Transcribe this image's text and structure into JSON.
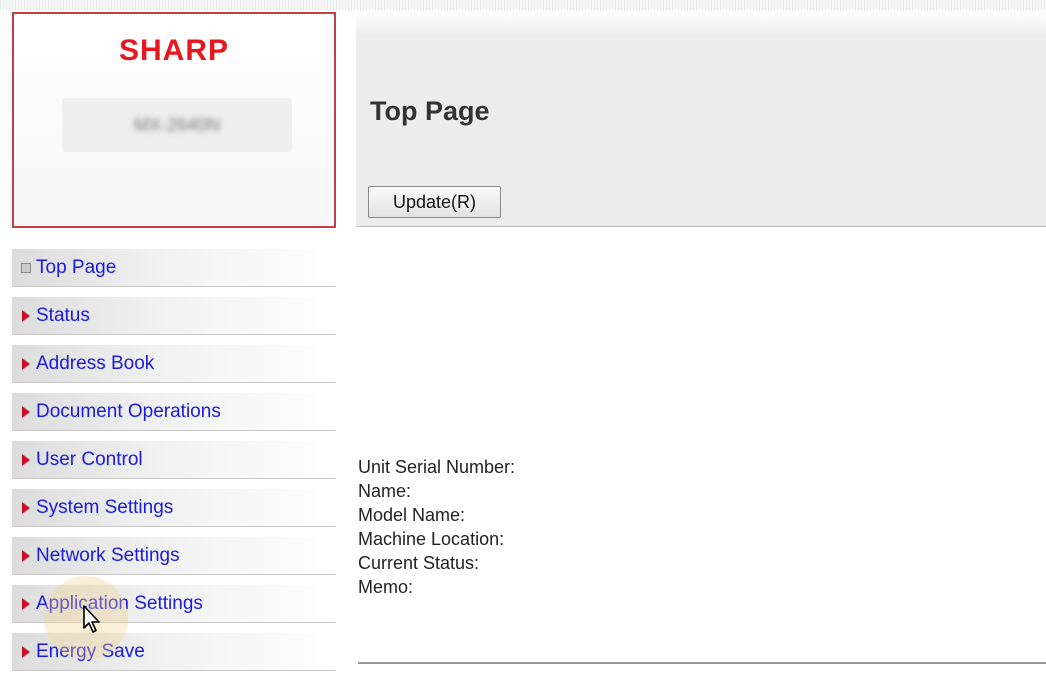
{
  "brand": {
    "logo_text": "SHARP",
    "model_name": "MX-2640N"
  },
  "header": {
    "title": "Top Page",
    "update_button": "Update(R)"
  },
  "sidebar": {
    "items": [
      {
        "label": "Top Page",
        "icon": "square-bullet-icon",
        "selected": true
      },
      {
        "label": "Status",
        "icon": "triangle-right-icon"
      },
      {
        "label": "Address Book",
        "icon": "triangle-right-icon"
      },
      {
        "label": "Document Operations",
        "icon": "triangle-right-icon"
      },
      {
        "label": "User Control",
        "icon": "triangle-right-icon"
      },
      {
        "label": "System Settings",
        "icon": "triangle-right-icon"
      },
      {
        "label": "Network Settings",
        "icon": "triangle-right-icon"
      },
      {
        "label": "Application Settings",
        "icon": "triangle-right-icon"
      },
      {
        "label": "Energy Save",
        "icon": "triangle-right-icon"
      }
    ]
  },
  "device_info": {
    "serial_label": "Unit Serial Number:",
    "name_label": "Name:",
    "model_label": "Model Name:",
    "location_label": "Machine Location:",
    "status_label": "Current Status:",
    "memo_label": "Memo:"
  },
  "colors": {
    "brand_red": "#e8161f",
    "link_blue": "#1a1ae0",
    "arrow_red": "#c8102e",
    "header_gray": "#ececec"
  }
}
